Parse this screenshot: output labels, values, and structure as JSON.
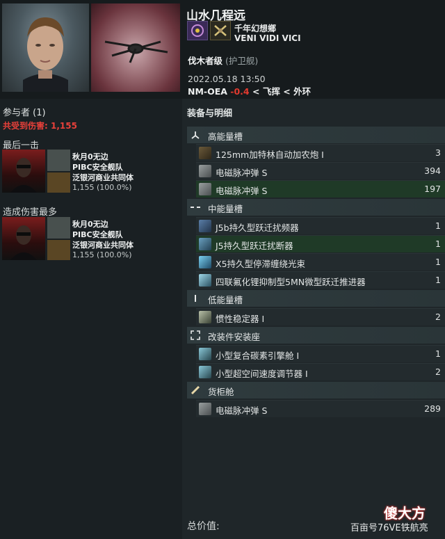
{
  "victim": {
    "name": "山水几程远",
    "corp": "千年幻想鄉",
    "alliance": "VENI VIDI VICI",
    "ship_name": "伐木者级",
    "ship_class": "(护卫舰)",
    "date": "2022.05.18 13:50",
    "system": "NM-OEA",
    "security": "-0.4",
    "region_sep": "<",
    "constellation": "飞挥",
    "region": "外环"
  },
  "involved": {
    "title": "参与者 (1)",
    "damage_taken_label": "共受到伤害:",
    "damage_taken_value": "1,155",
    "final_blow_title": "最后一击",
    "top_damage_title": "造成伤害最多",
    "final_blow": {
      "name": "秋月0无边",
      "corp": "PIBC安全舰队",
      "alliance": "泛银河商业共同体",
      "damage": "1,155 (100.0%)"
    },
    "top_damage": {
      "name": "秋月0无边",
      "corp": "PIBC安全舰队",
      "alliance": "泛银河商业共同体",
      "damage": "1,155 (100.0%)"
    }
  },
  "fitting": {
    "title": "装备与明细",
    "high_slots": "高能量槽",
    "mid_slots": "中能量槽",
    "low_slots": "低能量槽",
    "rigs": "改装件安装座",
    "cargo": "货柜舱",
    "high_items": [
      {
        "name": "125mm加特林自动加农炮 I",
        "qty": "3"
      },
      {
        "name": "电磁脉冲弹 S",
        "qty": "394"
      },
      {
        "name": "电磁脉冲弹 S",
        "qty": "197"
      }
    ],
    "mid_items": [
      {
        "name": "J5b持久型跃迁扰频器",
        "qty": "1"
      },
      {
        "name": "J5持久型跃迁扰断器",
        "qty": "1"
      },
      {
        "name": "X5持久型停滞缠绕光束",
        "qty": "1"
      },
      {
        "name": "四联氟化锂抑制型5MN微型跃迁推进器",
        "qty": "1"
      }
    ],
    "low_items": [
      {
        "name": "惯性稳定器 I",
        "qty": "2"
      }
    ],
    "rig_items": [
      {
        "name": "小型复合碳素引擎舱 I",
        "qty": "1"
      },
      {
        "name": "小型超空间速度调节器 I",
        "qty": "2"
      }
    ],
    "cargo_items": [
      {
        "name": "电磁脉冲弹 S",
        "qty": "289"
      }
    ],
    "total_label": "总价值:",
    "total_value": "百亩号76VE铁航亮"
  },
  "watermark": "傻大方",
  "colors": {
    "background": "#1d2427",
    "security_negative": "#e23a2f",
    "damage_red": "#e8403a",
    "dropped_row": "#1f3a27"
  },
  "icons": {
    "high": "high-slot-icon",
    "mid": "mid-slot-icon",
    "low": "low-slot-icon",
    "rig": "rig-slot-icon",
    "cargo": "cargo-icon"
  }
}
